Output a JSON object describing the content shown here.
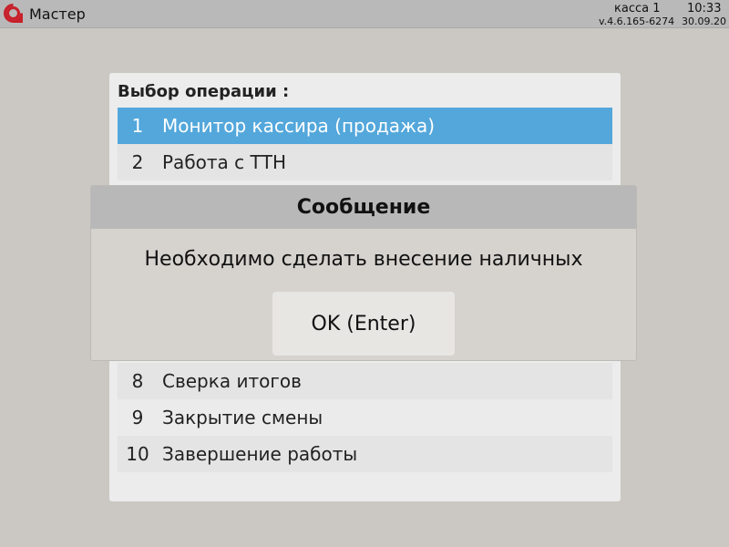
{
  "topbar": {
    "app_title": "Мастер",
    "register": "касса 1",
    "time": "10:33",
    "version": "v.4.6.165-6274",
    "date": "30.09.20",
    "logo_icon": "red-ring-logo-icon",
    "logo_color": "#c8202a"
  },
  "menu": {
    "title": "Выбор операции :",
    "selected_color": "#53a7db",
    "items": [
      {
        "num": "1",
        "label": "Монитор кассира (продажа)",
        "selected": true
      },
      {
        "num": "2",
        "label": "Работа с ТТН"
      },
      {
        "num": "8",
        "label": "Сверка итогов"
      },
      {
        "num": "9",
        "label": "Закрытие смены"
      },
      {
        "num": "10",
        "label": "Завершение работы"
      }
    ]
  },
  "dialog": {
    "title": "Сообщение",
    "message": "Необходимо сделать внесение наличных",
    "ok_label": "OK (Enter)"
  }
}
